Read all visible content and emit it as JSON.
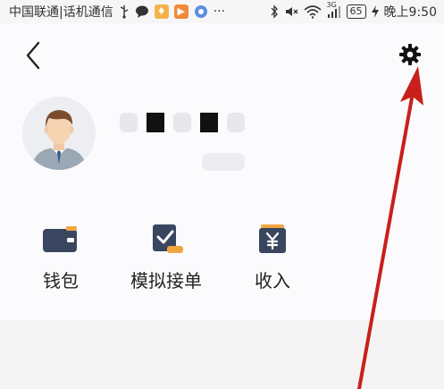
{
  "status_bar": {
    "carrier": "中国联通|话机通信",
    "battery": "65",
    "time": "晚上9:50",
    "network_label": "3G",
    "icons": [
      "usb-icon",
      "message-icon",
      "app-orange-icon",
      "app-video-icon",
      "browser-icon",
      "more-dots-icon",
      "bluetooth-icon",
      "mute-icon",
      "wifi-icon",
      "signal-icon",
      "battery-icon",
      "charging-icon"
    ]
  },
  "header": {
    "back_icon": "chevron-left-icon",
    "settings_icon": "gear-icon"
  },
  "profile": {
    "avatar_icon": "user-avatar-icon"
  },
  "menu": {
    "items": [
      {
        "label": "钱包",
        "icon": "wallet-icon"
      },
      {
        "label": "模拟接单",
        "icon": "simulated-order-icon"
      },
      {
        "label": "收入",
        "icon": "income-icon"
      }
    ]
  },
  "colors": {
    "accent_orange": "#f0a640",
    "icon_navy": "#3a4660",
    "arrow_red": "#c8201a"
  }
}
